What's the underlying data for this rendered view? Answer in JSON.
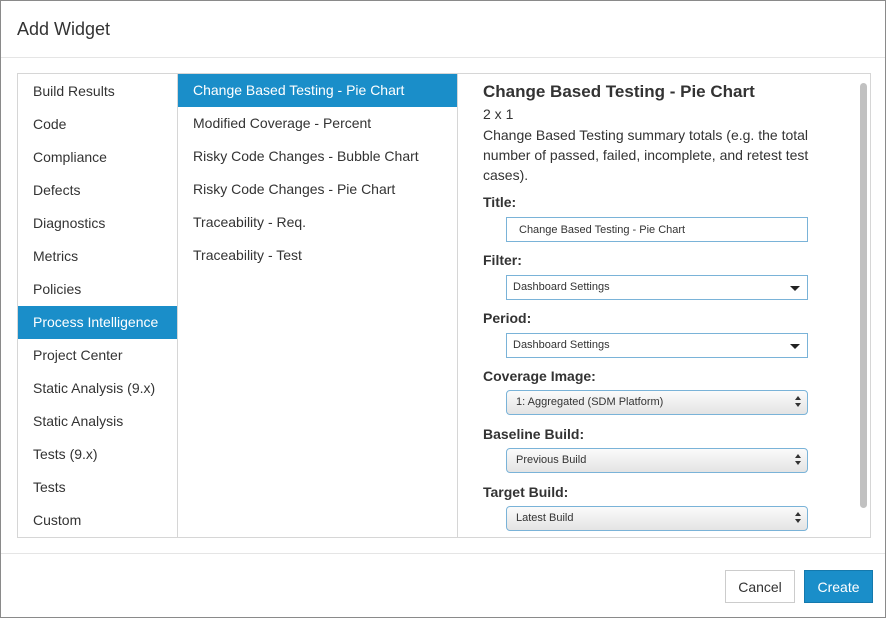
{
  "dialog": {
    "title": "Add Widget"
  },
  "categories": [
    {
      "label": "Build Results"
    },
    {
      "label": "Code"
    },
    {
      "label": "Compliance"
    },
    {
      "label": "Defects"
    },
    {
      "label": "Diagnostics"
    },
    {
      "label": "Metrics"
    },
    {
      "label": "Policies"
    },
    {
      "label": "Process Intelligence",
      "selected": true
    },
    {
      "label": "Project Center"
    },
    {
      "label": "Static Analysis (9.x)"
    },
    {
      "label": "Static Analysis"
    },
    {
      "label": "Tests (9.x)"
    },
    {
      "label": "Tests"
    },
    {
      "label": "Custom"
    }
  ],
  "widgets": [
    {
      "label": "Change Based Testing - Pie Chart",
      "selected": true
    },
    {
      "label": "Modified Coverage - Percent"
    },
    {
      "label": "Risky Code Changes - Bubble Chart"
    },
    {
      "label": "Risky Code Changes - Pie Chart"
    },
    {
      "label": "Traceability - Req."
    },
    {
      "label": "Traceability - Test"
    }
  ],
  "details": {
    "heading": "Change Based Testing - Pie Chart",
    "size": "2 x 1",
    "description": "Change Based Testing summary totals (e.g. the total number of passed, failed, incomplete, and retest test cases).",
    "fields": {
      "title": {
        "label": "Title:",
        "value": "Change Based Testing - Pie Chart"
      },
      "filter": {
        "label": "Filter:",
        "value": "Dashboard Settings"
      },
      "period": {
        "label": "Period:",
        "value": "Dashboard Settings"
      },
      "coverage_image": {
        "label": "Coverage Image:",
        "value": "1: Aggregated (SDM Platform)"
      },
      "baseline_build": {
        "label": "Baseline Build:",
        "value": "Previous Build"
      },
      "target_build": {
        "label": "Target Build:",
        "value": "Latest Build"
      }
    }
  },
  "footer": {
    "cancel_label": "Cancel",
    "create_label": "Create"
  },
  "colors": {
    "accent": "#1a8ec9",
    "border": "#d6d6d6",
    "input_border": "#7ab3d8"
  }
}
